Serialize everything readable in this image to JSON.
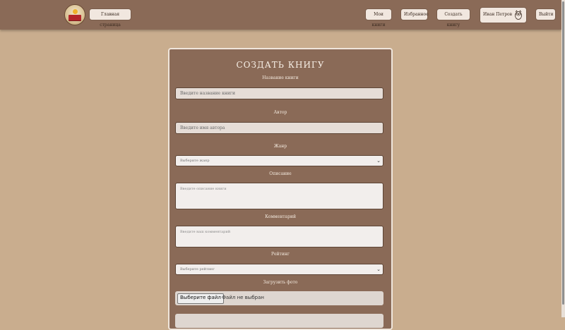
{
  "header": {
    "home_label": "Главная страница",
    "nav": [
      {
        "label": "Мои книги"
      },
      {
        "label": "Избранное"
      },
      {
        "label": "Создать книгу"
      }
    ],
    "user_name": "Иван Петров",
    "logout_label": "Выйти"
  },
  "form": {
    "title": "СОЗДАТЬ КНИГУ",
    "name_label": "Название книги",
    "name_placeholder": "Введите название книги",
    "author_label": "Автор",
    "author_placeholder": "Введите имя автора",
    "genre_label": "Жанр",
    "genre_selected": "Выберите жанр",
    "description_label": "Описание",
    "description_placeholder": "Введите описание книги",
    "comment_label": "Комментарий",
    "comment_placeholder": "Введите ваш комментарий",
    "rating_label": "Рейтинг",
    "rating_selected": "Выберите рейтинг",
    "photo_label": "Загрузить фото",
    "file_button": "Выберите файл",
    "file_status": "Файл не выбран"
  },
  "colors": {
    "page_bg": "#c9ad8e",
    "header_bg": "#8a6a57",
    "card_bg": "#8a6a57"
  }
}
